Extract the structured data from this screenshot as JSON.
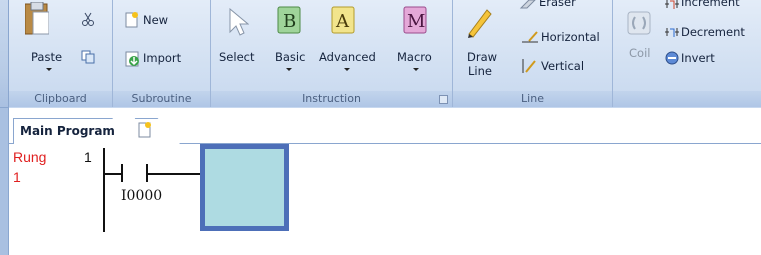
{
  "ribbon": {
    "groups": {
      "clipboard": {
        "label": "Clipboard",
        "paste": "Paste"
      },
      "subroutine": {
        "label": "Subroutine",
        "new": "New",
        "import": "Import"
      },
      "instruction": {
        "label": "Instruction",
        "select": "Select",
        "basic": "Basic",
        "advanced": "Advanced",
        "macro": "Macro"
      },
      "line": {
        "label": "Line",
        "draw_line_1": "Draw",
        "draw_line_2": "Line",
        "eraser": "Eraser",
        "horizontal": "Horizontal",
        "vertical": "Vertical"
      },
      "output": {
        "coil": "Coil",
        "increment": "Increment",
        "decrement": "Decrement",
        "invert": "Invert"
      }
    }
  },
  "tabs": {
    "main_program": "Main Program"
  },
  "ladder": {
    "rung_label": "Rung",
    "rung_label_num": "1",
    "rung_number": "1",
    "contact_address": "I0000"
  },
  "colors": {
    "rung_text": "#e02020",
    "selection_border": "#4d6fb8",
    "selection_fill": "#aedbe2"
  }
}
